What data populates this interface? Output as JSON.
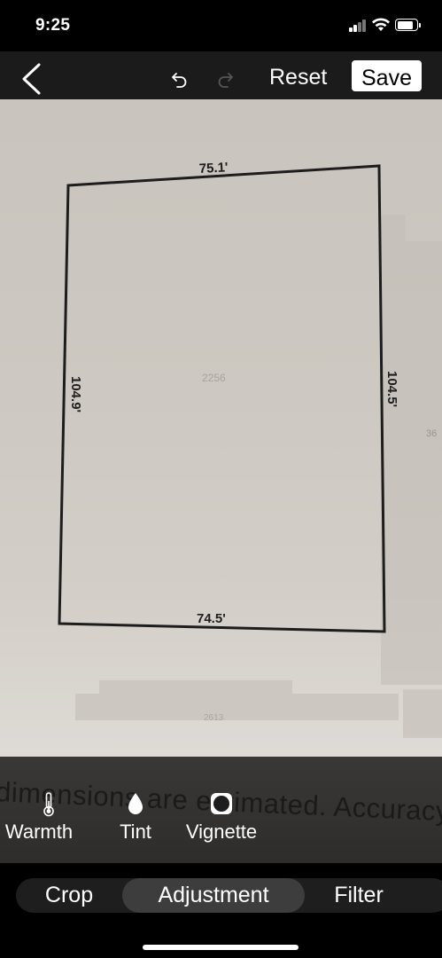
{
  "status_bar": {
    "time": "9:25"
  },
  "toolbar": {
    "reset_label": "Reset",
    "save_label": "Save"
  },
  "photo": {
    "top_dim": "75.1'",
    "left_dim": "104.9'",
    "right_dim": "104.5'",
    "bottom_dim": "74.5'",
    "center_text": "2256",
    "lower_text": "2613",
    "right_edge_text": "36"
  },
  "caption_text": "dimensions are estimated. Accuracy is",
  "adjust_tools": [
    {
      "label": "Warmth",
      "icon": "thermometer-icon"
    },
    {
      "label": "Tint",
      "icon": "droplet-icon"
    },
    {
      "label": "Vignette",
      "icon": "vignette-icon"
    }
  ],
  "tabs": [
    {
      "label": "Crop",
      "active": false
    },
    {
      "label": "Adjustment",
      "active": true
    },
    {
      "label": "Filter",
      "active": false
    }
  ],
  "colors": {
    "background": "#000000",
    "toolbar": "#1b1b1b",
    "active_tab": "#3d3d3d",
    "paper": "#cdc8c1"
  }
}
